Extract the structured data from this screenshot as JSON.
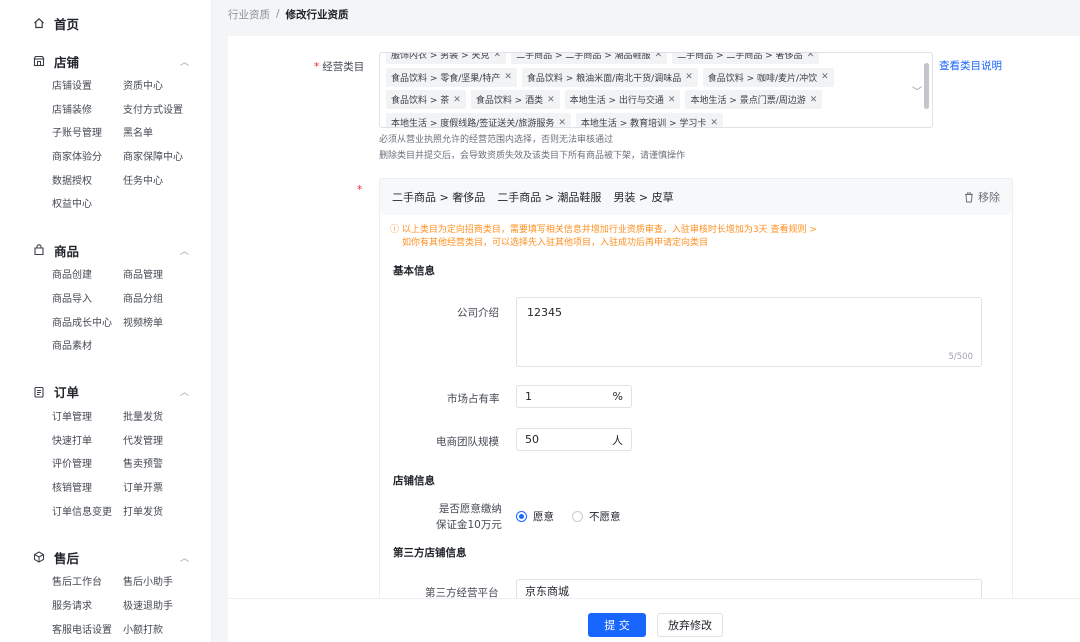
{
  "sidebar": {
    "home": "首页",
    "sections": [
      {
        "title": "店铺",
        "icon": "store-icon",
        "items": [
          "店铺设置",
          "资质中心",
          "店铺装修",
          "支付方式设置",
          "子账号管理",
          "黑名单",
          "商家体验分",
          "商家保障中心",
          "数据授权",
          "任务中心",
          "权益中心"
        ]
      },
      {
        "title": "商品",
        "icon": "goods-icon",
        "items": [
          "商品创建",
          "商品管理",
          "商品导入",
          "商品分组",
          "商品成长中心",
          "视频榜单",
          "商品素材"
        ]
      },
      {
        "title": "订单",
        "icon": "order-icon",
        "items": [
          "订单管理",
          "批量发货",
          "快速打单",
          "代发管理",
          "评价管理",
          "售卖预警",
          "核销管理",
          "订单开票",
          "订单信息变更",
          "打单发货"
        ]
      },
      {
        "title": "售后",
        "icon": "aftersale-icon",
        "items": [
          "售后工作台",
          "售后小助手",
          "服务请求",
          "极速退助手",
          "客服电话设置",
          "小额打款"
        ]
      }
    ]
  },
  "breadcrumb": {
    "parent": "行业资质",
    "sep": "/",
    "current": "修改行业资质"
  },
  "form": {
    "category_label": "经营类目",
    "category_tags": [
      [
        "服饰内衣 > 男装 > 夹克",
        "二手商品 > 二手商品 > 潮品鞋服",
        "二手商品 > 二手商品 > 奢侈品"
      ],
      [
        "食品饮料 > 零食/坚果/特产",
        "食品饮料 > 粮油米面/南北干货/调味品",
        "食品饮料 > 咖啡/麦片/冲饮"
      ],
      [
        "食品饮料 > 茶",
        "食品饮料 > 酒类",
        "本地生活 > 出行与交通",
        "本地生活 > 景点门票/周边游"
      ],
      [
        "本地生活 > 度假线路/签证送关/旅游服务",
        "本地生活 > 教育培训 > 学习卡"
      ]
    ],
    "view_category_link": "查看类目说明",
    "hint1": "必须从营业执照允许的经营范围内选择，否则无法审核通过",
    "hint2": "删除类目并提交后，会导致资质失效及该类目下所有商品被下架，请谨慎操作"
  },
  "qualification": {
    "categories": [
      "二手商品 > 奢侈品",
      "二手商品 > 潮品鞋服",
      "男装 > 皮草"
    ],
    "remove_label": "移除",
    "warning_line1": "以上类目为定向招商类目，需要填写相关信息并增加行业资质审查，入驻审核时长增加为3天",
    "warning_link": "查看规则 >",
    "warning_line2": "如你有其他经营类目，可以选择先入驻其他项目，入驻成功后再申请定向类目",
    "basic_info_title": "基本信息",
    "company_intro_label": "公司介绍",
    "company_intro_value": "12345",
    "company_intro_count": "5/500",
    "market_share_label": "市场占有率",
    "market_share_value": "1",
    "market_share_suffix": "%",
    "team_size_label": "电商团队规模",
    "team_size_value": "50",
    "team_size_suffix": "人",
    "shop_info_title": "店铺信息",
    "deposit_label_1": "是否愿意缴纳",
    "deposit_label_2": "保证金10万元",
    "deposit_options": [
      "愿意",
      "不愿意"
    ],
    "deposit_selected": "愿意",
    "third_party_title": "第三方店铺信息",
    "third_platform_label": "第三方经营平台",
    "third_platform_value": "京东商城"
  },
  "footer": {
    "submit": "提 交",
    "discard": "放弃修改"
  },
  "colors": {
    "primary": "#1966ff",
    "warning": "#ff8f1f",
    "required": "#f5222d"
  }
}
